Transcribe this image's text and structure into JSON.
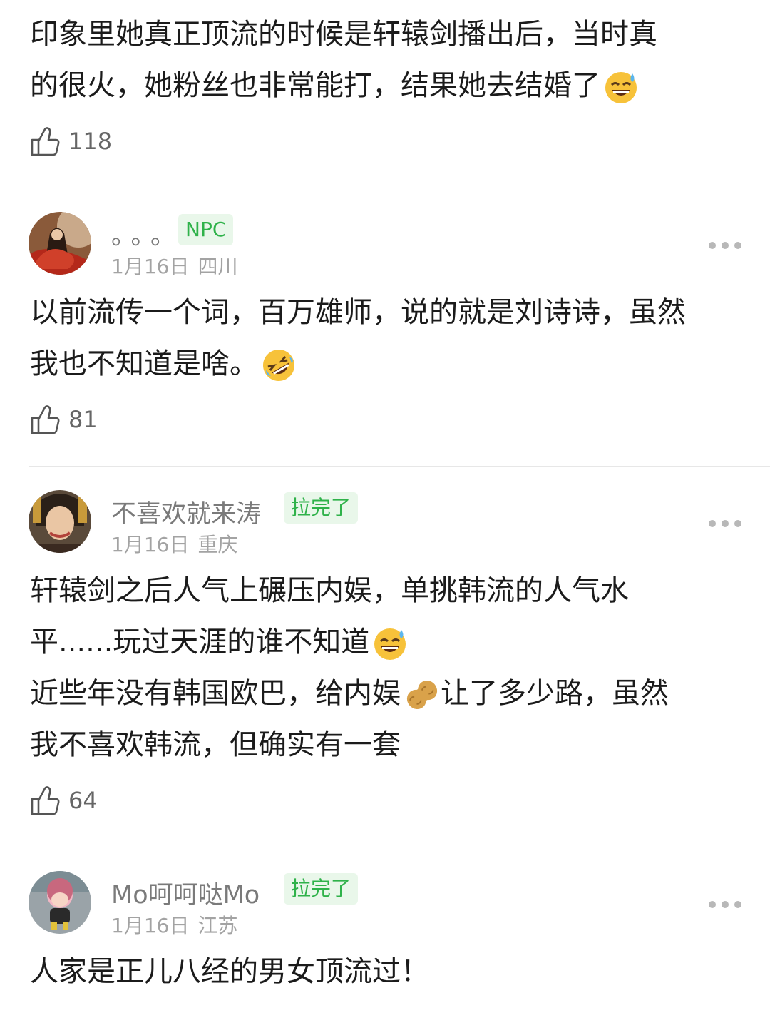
{
  "comments": [
    {
      "text_lines": [
        "印象里她真正顶流的时候是轩辕剑播出后，当时真",
        "的很火，她粉丝也非常能打，结果她去结婚了"
      ],
      "likes": "118"
    },
    {
      "username": "。。。",
      "badge": "NPC",
      "date": "1月16日",
      "location": "四川",
      "text_lines": [
        "以前流传一个词，百万雄师，说的就是刘诗诗，虽然",
        "我也不知道是啥。"
      ],
      "likes": "81"
    },
    {
      "username": "不喜欢就来涛",
      "badge": "拉完了",
      "date": "1月16日",
      "location": "重庆",
      "text_lines": [
        "轩辕剑之后人气上碾压内娱，单挑韩流的人气水",
        "平......玩过天涯的谁不知道",
        "近些年没有韩国欧巴，给内娱",
        "我不喜欢韩流，但确实有一套"
      ],
      "text_line3_suffix": "让了多少路，虽然",
      "likes": "64"
    },
    {
      "username": "Mo呵呵哒Mo",
      "badge": "拉完了",
      "date": "1月16日",
      "location": "江苏",
      "text_lines": [
        "人家是正儿八经的男女顶流过！"
      ]
    }
  ],
  "icons": [
    "thumbs-up-icon",
    "more-dots-icon",
    "sweat-smile-emoji",
    "rofl-emoji",
    "peanut-emoji"
  ],
  "colors": {
    "badge_bg": "#e9f7ea",
    "badge_text": "#2fb24a",
    "username": "#7a7a7a",
    "meta": "#a3a3a3"
  }
}
